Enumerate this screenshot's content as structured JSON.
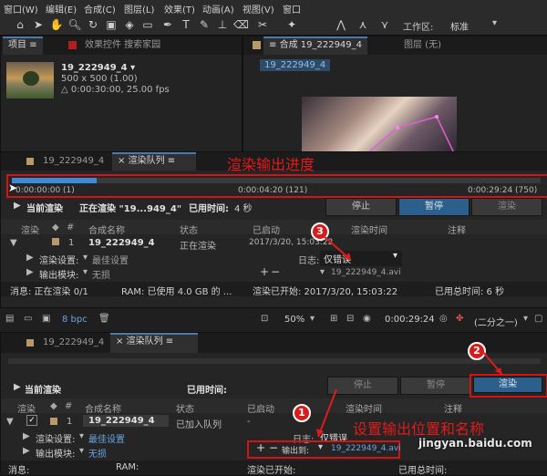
{
  "menu": [
    "窗口(W)",
    "编辑(E)",
    "合成(C)",
    "图层(L)",
    "效果(T)",
    "动画(A)",
    "视图(V)",
    "窗口"
  ],
  "toolbar": {
    "workspace_label": "工作区:",
    "workspace_value": "标准"
  },
  "project_panel": {
    "tab_project": "项目",
    "tab_effects": "效果控件 搜索家园",
    "item_name": "19_222949_4 ▾",
    "item_dims": "500 x 500 (1.00)",
    "item_duration": "△ 0:00:30:00, 25.00 fps"
  },
  "comp_panel": {
    "tab_comp": "合成 19_222949_4",
    "tab_layer": "图层 (无)",
    "subtab": "19_222949_4",
    "zoom": "50%",
    "timecode": "0:00:29:24",
    "resolution": "(二分之一)",
    "bpc": "8 bpc"
  },
  "render_top": {
    "tab_comp": "19_222949_4",
    "tab_queue": "渲染队列",
    "progress_title": "渲染输出进度",
    "time_start": "0:00:00:00 (1)",
    "time_mid": "0:00:04:20 (121)",
    "time_end": "0:00:29:24 (750)",
    "progress": 0.16,
    "current_render": "当前渲染",
    "rendering_label": "正在渲染 \"19...949_4\"",
    "elapsed_label": "已用时间:",
    "elapsed_value": "4 秒",
    "btn_stop": "停止",
    "btn_pause": "暂停",
    "btn_render": "渲染",
    "cols": {
      "render": "渲染",
      "num": "#",
      "comp": "合成名称",
      "status": "状态",
      "started": "已启动",
      "render_time": "渲染时间",
      "comment": "注释"
    },
    "row_num": "1",
    "row_comp": "19_222949_4",
    "row_status": "正在渲染",
    "row_started": "2017/3/20, 15:03:22",
    "settings_label": "渲染设置:",
    "settings_value": "最佳设置",
    "log_label": "日志:",
    "log_value": "仅错误",
    "output_module_label": "输出模块:",
    "output_module_value": "无损",
    "output_to_file": "19_222949_4.avi",
    "status_msg": "消息: 正在渲染 0/1",
    "status_ram": "RAM: 已使用 4.0 GB 的 ...",
    "status_started": "渲染已开始: 2017/3/20, 15:03:22",
    "status_total": "已用总时间: 6 秒",
    "marker": "3"
  },
  "render_bottom": {
    "tab_comp": "19_222949_4",
    "tab_queue": "渲染队列",
    "current_render": "当前渲染",
    "elapsed_label": "已用时间:",
    "btn_stop": "停止",
    "btn_pause": "暂停",
    "btn_render": "渲染",
    "cols": {
      "render": "渲染",
      "num": "#",
      "comp": "合成名称",
      "status": "状态",
      "started": "已启动",
      "render_time": "渲染时间",
      "comment": "注释"
    },
    "row_num": "1",
    "row_comp": "19_222949_4",
    "row_status": "已加入队列",
    "row_started": "-",
    "settings_label": "渲染设置:",
    "settings_value": "最佳设置",
    "log_label": "日志:",
    "log_value": "仅错误",
    "output_module_label": "输出模块:",
    "output_module_value": "无损",
    "output_to_label": "输出到:",
    "output_to_file": "19_222949_4.avi",
    "annotation": "设置输出位置和名称",
    "marker_1": "1",
    "marker_2": "2",
    "status_msg": "消息:",
    "status_ram": "RAM:",
    "status_started": "渲染已开始:",
    "status_total": "已用总时间:"
  },
  "watermark": "jingyan.baidu.com"
}
